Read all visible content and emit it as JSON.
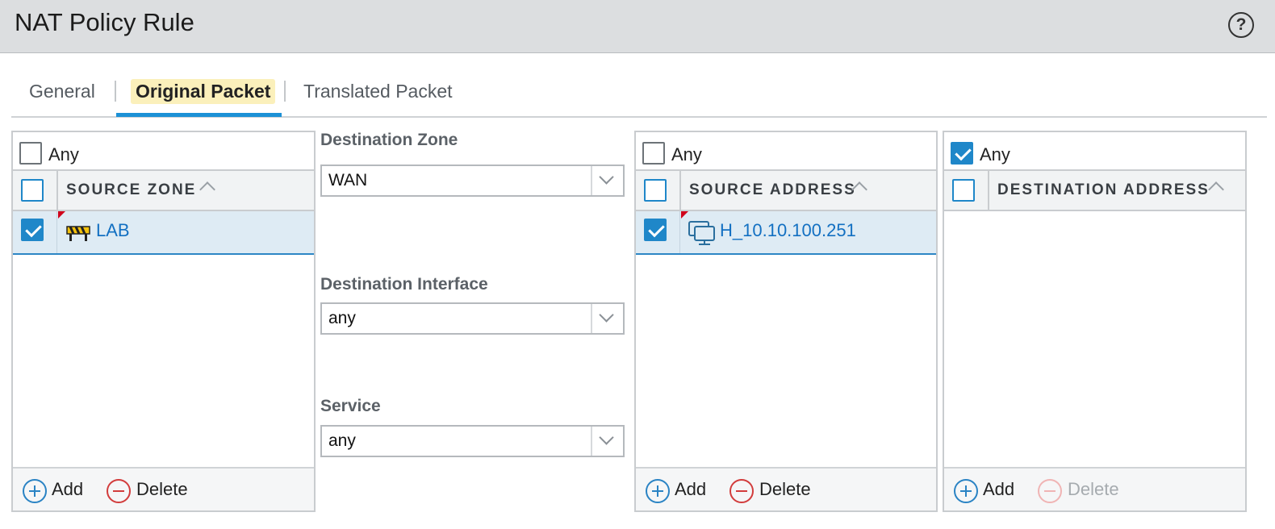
{
  "header": {
    "title": "NAT Policy Rule",
    "help_icon": "help-circle-icon"
  },
  "tabs": [
    {
      "label": "General",
      "active": false
    },
    {
      "label": "Original Packet",
      "active": true
    },
    {
      "label": "Translated Packet",
      "active": false
    }
  ],
  "source_zone": {
    "any_label": "Any",
    "any_checked": false,
    "column_header": "SOURCE ZONE",
    "rows": [
      {
        "name": "LAB",
        "checked": true,
        "icon": "zone-icon"
      }
    ],
    "add_label": "Add",
    "delete_label": "Delete"
  },
  "destination": {
    "zone_label": "Destination Zone",
    "zone_value": "WAN",
    "interface_label": "Destination Interface",
    "interface_value": "any",
    "service_label": "Service",
    "service_value": "any"
  },
  "source_address": {
    "any_label": "Any",
    "any_checked": false,
    "column_header": "SOURCE ADDRESS",
    "rows": [
      {
        "name": "H_10.10.100.251",
        "checked": true,
        "icon": "host-address-icon"
      }
    ],
    "add_label": "Add",
    "delete_label": "Delete"
  },
  "destination_address": {
    "any_label": "Any",
    "any_checked": true,
    "column_header": "DESTINATION ADDRESS",
    "rows": [],
    "add_label": "Add",
    "delete_label": "Delete",
    "delete_disabled": true
  },
  "colors": {
    "accent": "#1f87c9",
    "link": "#1370c2",
    "active_tab_bg": "#fbf0bb",
    "selected_row": "#deebf4",
    "delete_red": "#d23c3c"
  }
}
